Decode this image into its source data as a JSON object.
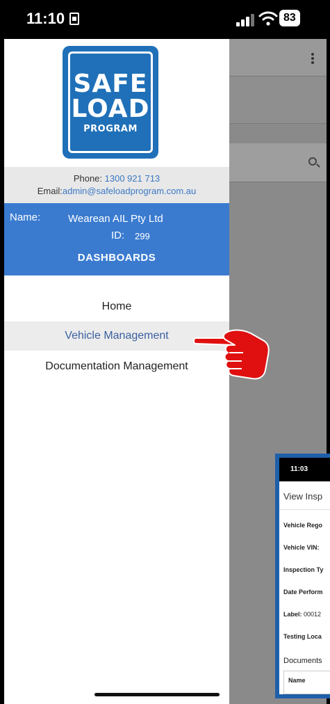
{
  "status_bar": {
    "time": "11:10",
    "battery": "83"
  },
  "drawer": {
    "logo": {
      "line1": "SAFE",
      "line2": "LOAD",
      "line3": "PROGRAM"
    },
    "contact": {
      "phone_label": "Phone:",
      "phone_value": "1300 921 713",
      "email_label": "Email:",
      "email_value": "admin@safeloadprogram.com.au"
    },
    "account": {
      "name_label": "Name:",
      "name_value": "Wearean AIL Pty Ltd",
      "id_label": "ID:",
      "id_value": "299"
    },
    "section_title": "DASHBOARDS",
    "menu": [
      {
        "label": "Home"
      },
      {
        "label": "Vehicle Management"
      },
      {
        "label": "Documentation Management"
      }
    ]
  },
  "inset": {
    "time": "11:03",
    "title": "View Insp",
    "rows": [
      {
        "text": "Vehicle Rego"
      },
      {
        "text": "Vehicle VIN:"
      },
      {
        "text": "Inspection Ty"
      },
      {
        "text": "Date Perform"
      },
      {
        "label": "Label:",
        "value": "00012"
      },
      {
        "text": "Testing Loca"
      }
    ],
    "documents_label": "Documents",
    "table_header": "Name"
  },
  "colors": {
    "brand_blue": "#1f70b8",
    "band_blue": "#3a7bd0",
    "link_blue": "#3a78c4",
    "pointer_red": "#e01010"
  }
}
